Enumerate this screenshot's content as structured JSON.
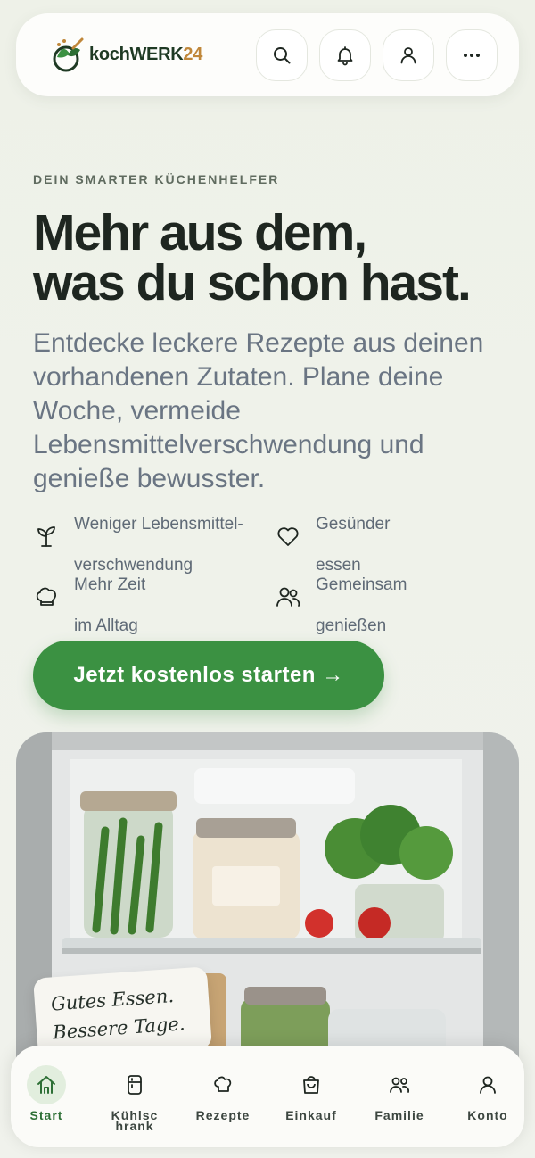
{
  "header": {
    "logo_text": "kochWERK",
    "logo_num": "24",
    "actions": [
      {
        "icon": "search-icon"
      },
      {
        "icon": "bell-icon"
      },
      {
        "icon": "user-icon"
      },
      {
        "icon": "more-icon"
      }
    ]
  },
  "hero": {
    "eyebrow": "DEIN SMARTER KÜCHENHELFER",
    "headline_line1": "Mehr aus dem,",
    "headline_line2": "was du schon hast.",
    "subline": "Entdecke leckere Rezepte aus deinen vorhandenen Zutaten. Plane deine Woche, vermeide Lebensmittelverschwendung und genieße bewusster.",
    "benefits": [
      {
        "line1": "Weniger Lebensmittel-",
        "line2": "verschwendung",
        "icon": "sprout-icon"
      },
      {
        "line1": "Gesünder",
        "line2": "essen",
        "icon": "heart-icon"
      },
      {
        "line1": "Mehr Zeit",
        "line2": "im Alltag",
        "icon": "chef-hat-icon"
      },
      {
        "line1": "Gemeinsam",
        "line2": "genießen",
        "icon": "people-icon"
      }
    ],
    "cta_label": "Jetzt kostenlos starten →"
  },
  "note": {
    "line1": "Gutes Essen.",
    "line2": "Bessere Tage. ♥"
  },
  "nav": {
    "items": [
      {
        "label": "Start",
        "icon": "home-icon",
        "active": true
      },
      {
        "label": "Kühlschrank",
        "icon": "fridge-icon"
      },
      {
        "label": "Rezepte",
        "icon": "chef-hat-icon"
      },
      {
        "label": "Einkauf",
        "icon": "shopping-bag-icon"
      },
      {
        "label": "Familie",
        "icon": "people-icon"
      },
      {
        "label": "Konto",
        "icon": "user-icon"
      }
    ]
  },
  "colors": {
    "accent": "#3b9142",
    "text_dark": "#1e2620",
    "text_muted": "#6a7583",
    "logo_number": "#c0873a"
  }
}
